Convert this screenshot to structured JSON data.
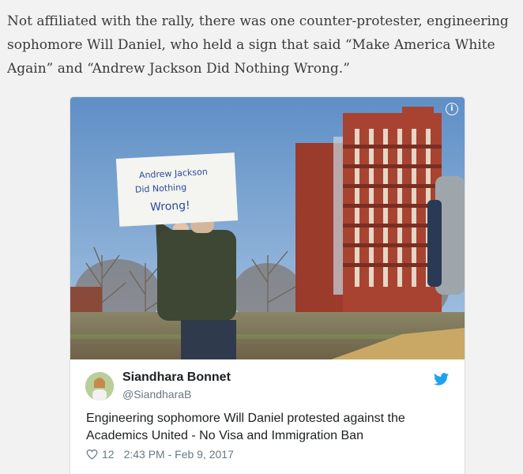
{
  "article": {
    "paragraph": "Not affiliated with the rally, there was one counter-protester, engineering sophomore Will Daniel, who held a sign that said “Make America White Again” and “Andrew Jackson Did Nothing Wrong.”"
  },
  "tweet": {
    "media": {
      "sign_line1": "Andrew Jackson",
      "sign_line2": "Did Nothing",
      "sign_line3": "Wrong!",
      "info_glyph": "i"
    },
    "author_name": "Siandhara Bonnet",
    "author_handle": "@SiandharaB",
    "text": "Engineering sophomore Will Daniel protested against the Academics United - No Visa and Immigration Ban",
    "like_count": "12",
    "timestamp": "2:43 PM - Feb 9, 2017",
    "icons": {
      "brand": "twitter-bird-icon",
      "like": "heart-icon",
      "info": "info-icon"
    },
    "colors": {
      "brand": "#1da1f2",
      "text": "#1c2022",
      "muted": "#697882"
    }
  }
}
